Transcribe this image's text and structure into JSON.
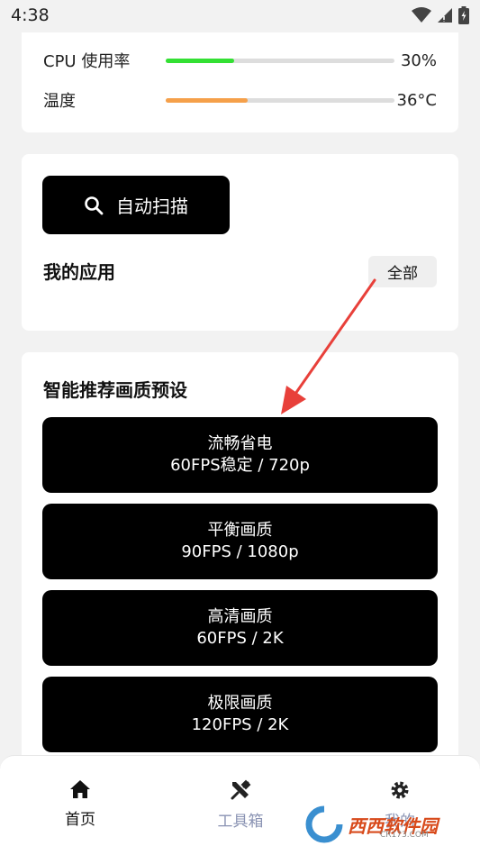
{
  "status_bar": {
    "time": "4:38"
  },
  "stats": [
    {
      "label": "CPU 使用率",
      "value": "30%",
      "level": 0.3,
      "color": "#33e033"
    },
    {
      "label": "温度",
      "value": "36°C",
      "level": 0.36,
      "color": "#f5a04a"
    }
  ],
  "apps": {
    "scan_label": "自动扫描",
    "title": "我的应用",
    "all_label": "全部"
  },
  "presets": {
    "title": "智能推荐画质预设",
    "items": [
      {
        "name": "流畅省电",
        "spec": "60FPS稳定 / 720p"
      },
      {
        "name": "平衡画质",
        "spec": "90FPS / 1080p"
      },
      {
        "name": "高清画质",
        "spec": "60FPS / 2K"
      },
      {
        "name": "极限画质",
        "spec": "120FPS / 2K"
      }
    ]
  },
  "nav": {
    "items": [
      {
        "label": "首页",
        "icon": "home-icon",
        "active": true
      },
      {
        "label": "工具箱",
        "icon": "tools-icon",
        "active": false
      },
      {
        "label": "我的",
        "icon": "gear-icon",
        "active": false
      }
    ]
  },
  "watermark": {
    "text": "西西软件园",
    "sub": "CR173.COM"
  },
  "colors": {
    "accent_active": "#111111",
    "inactive": "#8a93b3",
    "arrow": "#e8403a"
  }
}
